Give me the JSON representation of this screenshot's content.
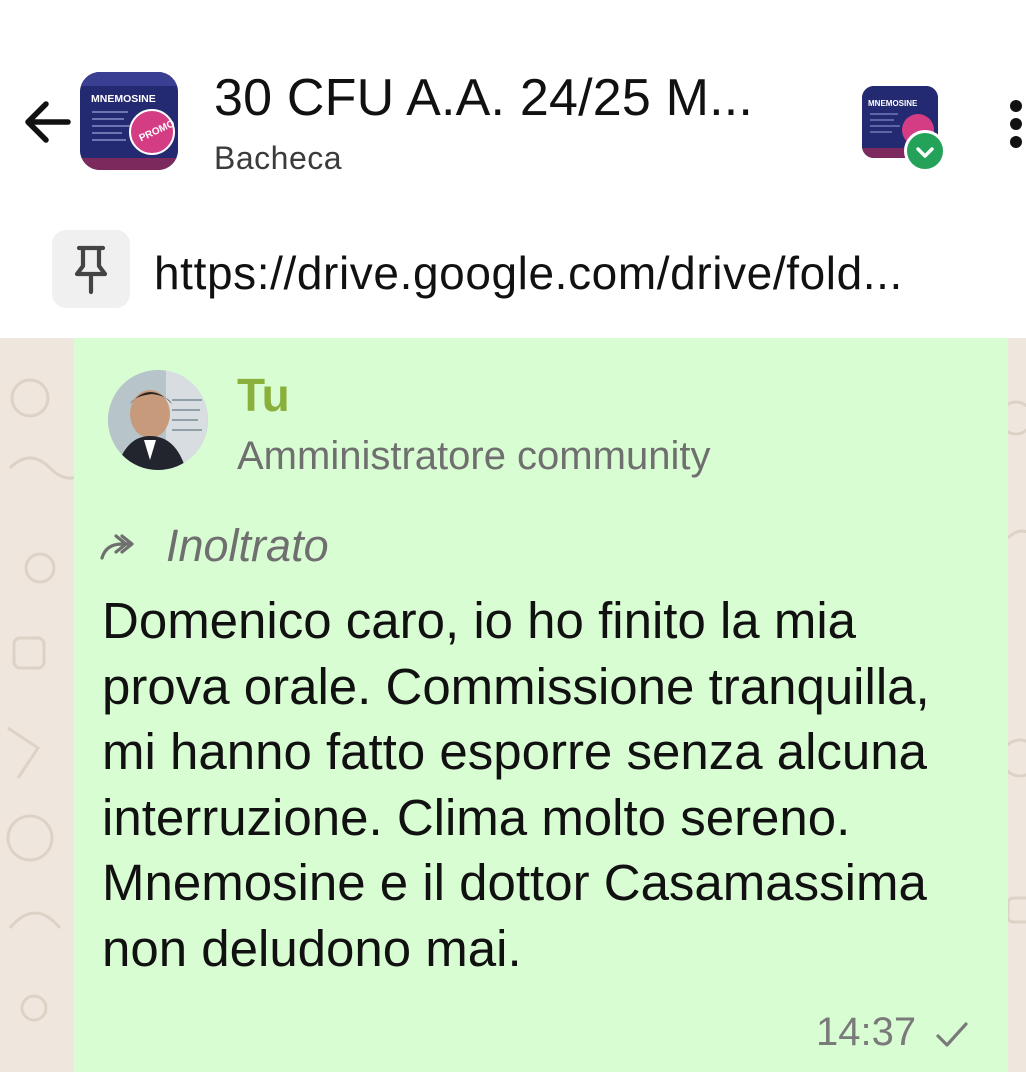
{
  "header": {
    "title": "30 CFU A.A. 24/25 M...",
    "subtitle": "Bacheca",
    "group_logo_text": "MNEMOSINE",
    "group_logo_badge": "PROMO"
  },
  "pinned": {
    "text": "https://drive.google.com/drive/fold..."
  },
  "message": {
    "sender_name": "Tu",
    "sender_role": "Amministratore community",
    "forwarded_label": "Inoltrato",
    "body": "Domenico caro, io ho finito la mia prova orale. Commissione tranquilla, mi hanno fatto esporre senza alcuna interruzione. Clima molto sereno. Mnemosine e il dottor Casamassima non deludono mai.",
    "time": "14:37"
  },
  "colors": {
    "bubble": "#d9fdd3",
    "chat_bg": "#efe7de",
    "sender_name": "#8ab03c",
    "verified_badge": "#25a25a"
  },
  "icons": {
    "back": "arrow-left-icon",
    "more": "more-vert-icon",
    "pin": "pin-icon",
    "forward": "forward-icon",
    "sent": "check-icon",
    "verified": "check-circle-icon"
  }
}
